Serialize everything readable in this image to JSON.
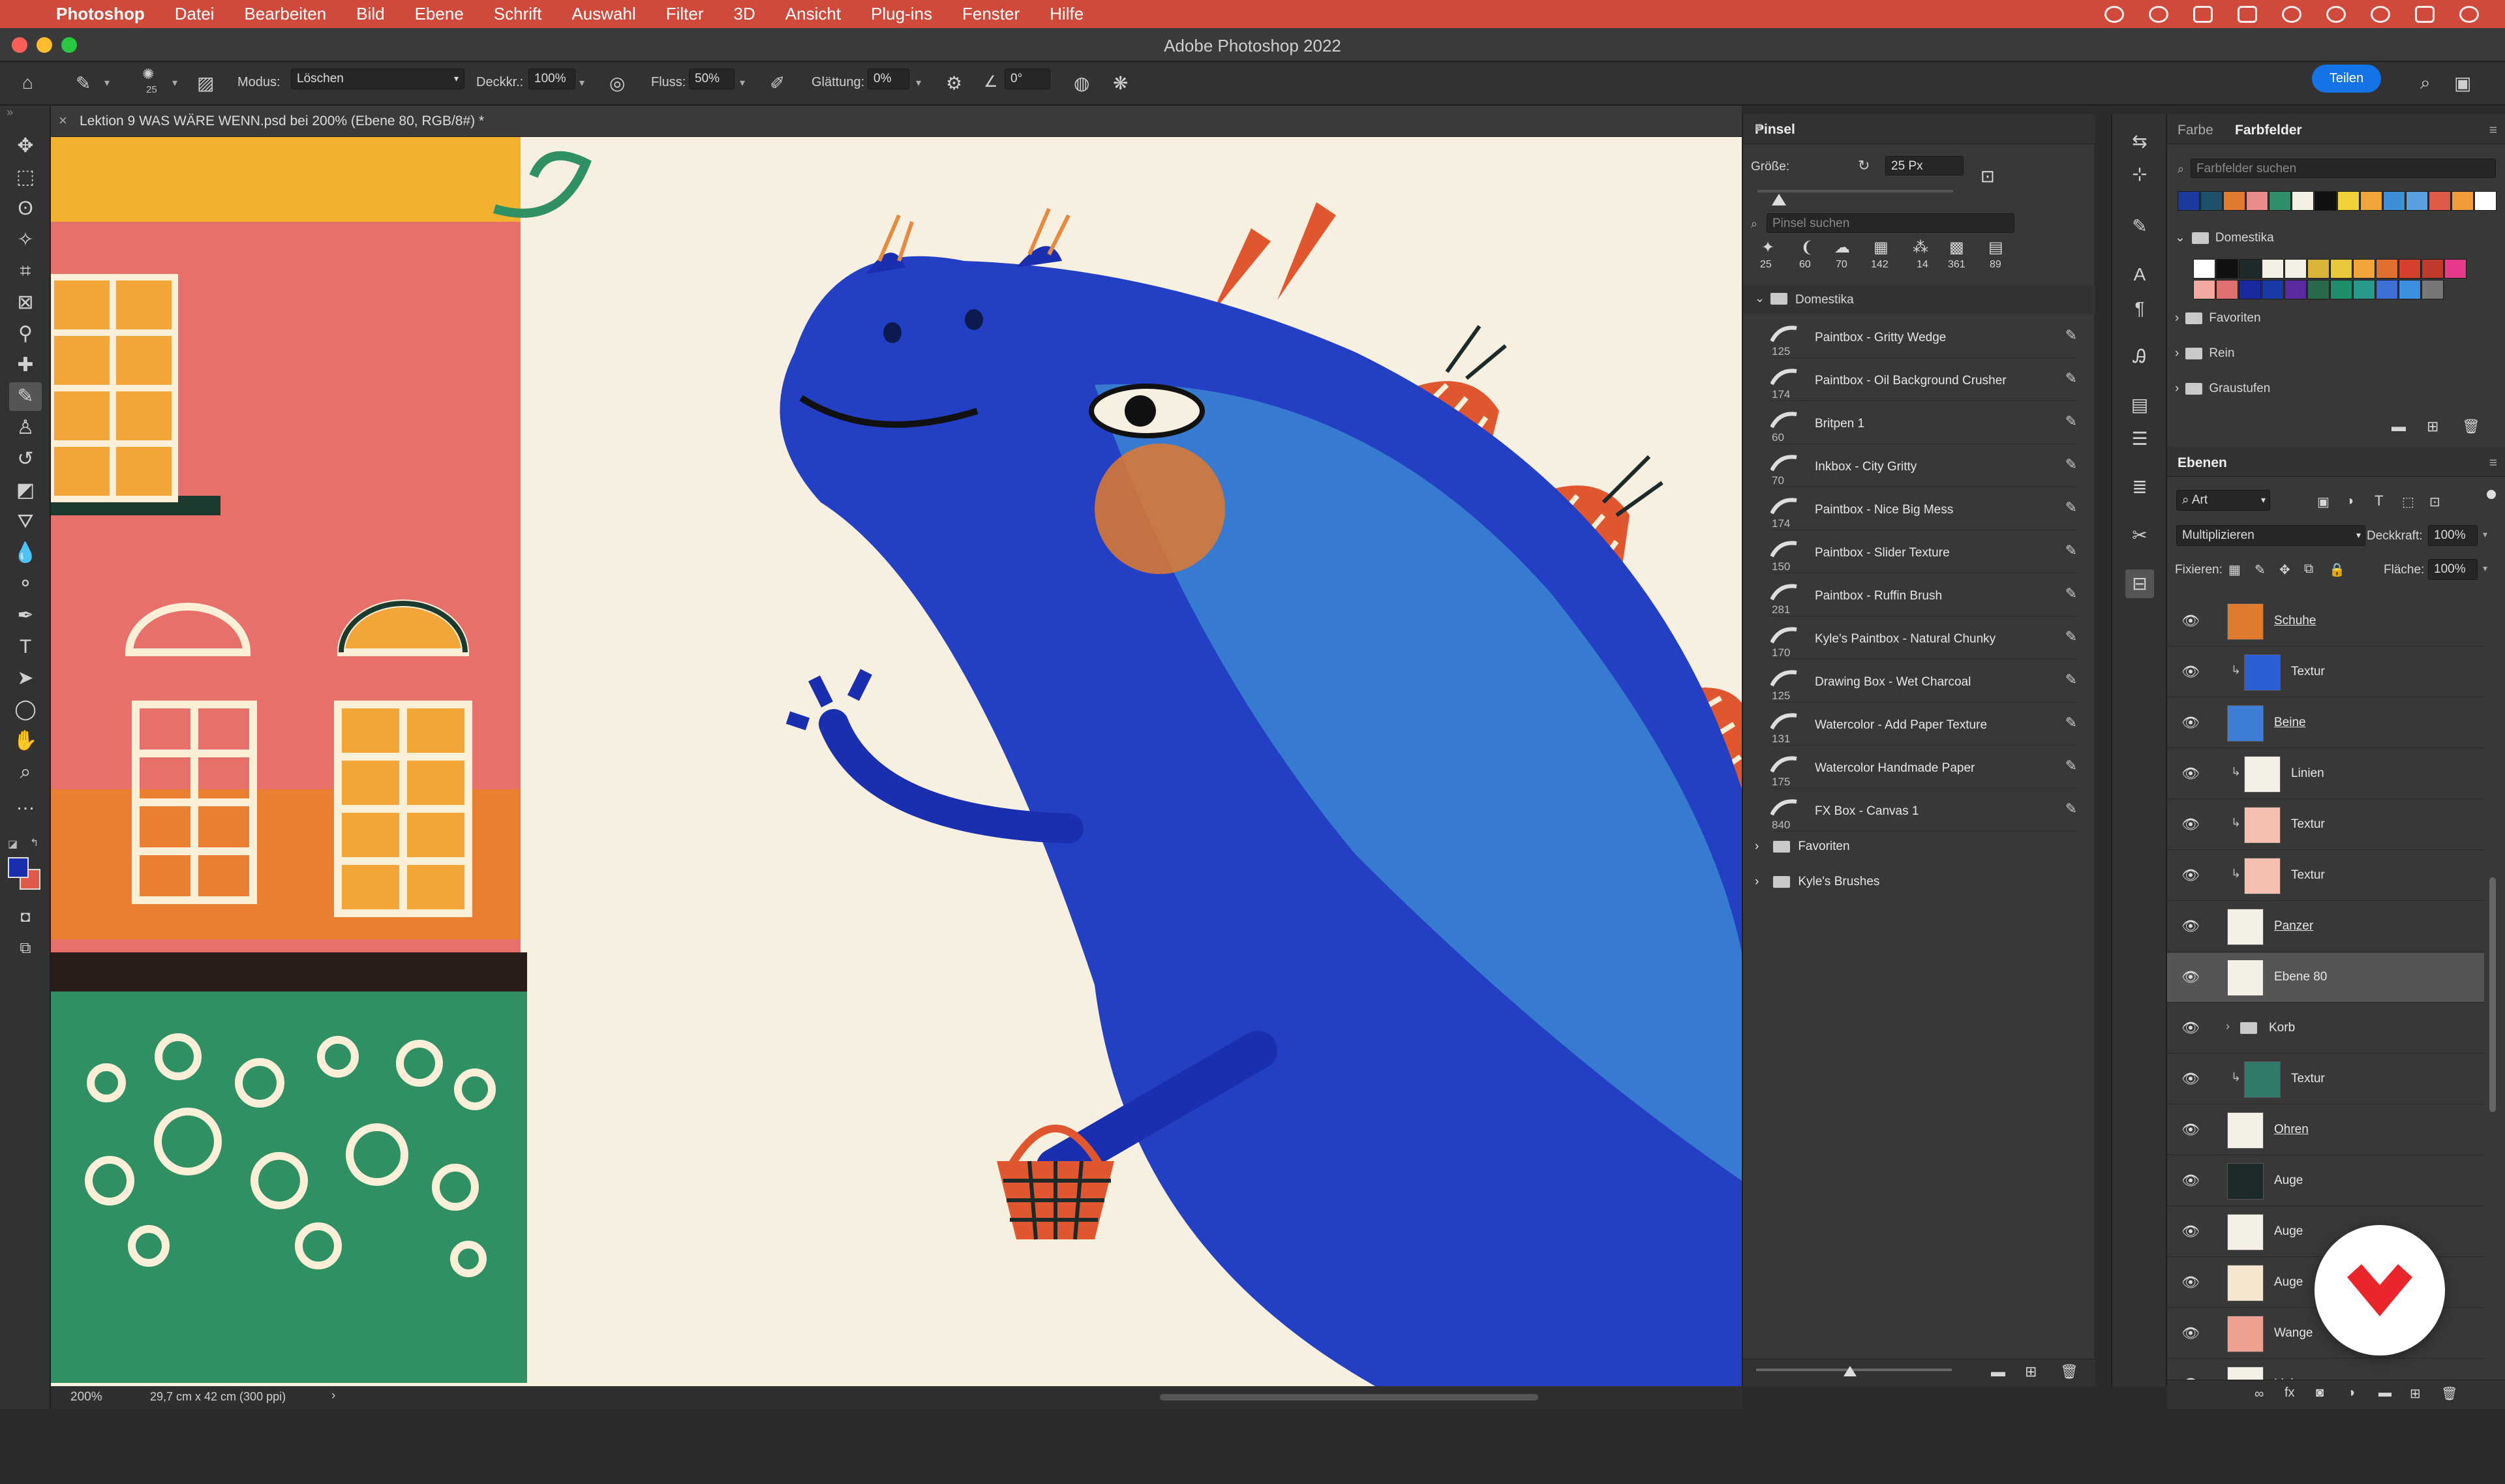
{
  "menubar": {
    "app_name": "Photoshop",
    "items": [
      "Datei",
      "Bearbeiten",
      "Bild",
      "Ebene",
      "Schrift",
      "Auswahl",
      "Filter",
      "3D",
      "Ansicht",
      "Plug-ins",
      "Fenster",
      "Hilfe"
    ],
    "color": "#cf4a3b"
  },
  "window": {
    "title": "Adobe Photoshop 2022"
  },
  "options": {
    "mode_label": "Modus:",
    "mode_value": "Löschen",
    "opacity_label": "Deckkr.:",
    "opacity_value": "100%",
    "flow_label": "Fluss:",
    "flow_value": "50%",
    "smoothing_label": "Glättung:",
    "smoothing_value": "0%",
    "angle_value": "0°",
    "brush_size_small": "25",
    "share_label": "Teilen"
  },
  "document": {
    "tab_title": "Lektion 9 WAS WÄRE WENN.psd bei 200% (Ebene 80, RGB/8#) *",
    "zoom": "200%",
    "doc_size": "29,7 cm x 42 cm (300 ppi)"
  },
  "brush_panel": {
    "title": "Pinsel",
    "size_label": "Größe:",
    "size_value": "25 Px",
    "search_placeholder": "Pinsel suchen",
    "size_presets": [
      "25",
      "60",
      "70",
      "142",
      "14",
      "361",
      "89"
    ],
    "group": "Domestika",
    "brushes": [
      {
        "name": "Paintbox - Gritty Wedge",
        "size": "125"
      },
      {
        "name": "Paintbox - Oil Background Crusher",
        "size": "174"
      },
      {
        "name": "Britpen 1",
        "size": "60"
      },
      {
        "name": "Inkbox - City Gritty",
        "size": "70"
      },
      {
        "name": "Paintbox - Nice Big Mess",
        "size": "174"
      },
      {
        "name": "Paintbox - Slider Texture",
        "size": "150"
      },
      {
        "name": "Paintbox - Ruffin Brush",
        "size": "281"
      },
      {
        "name": "Kyle's Paintbox - Natural Chunky",
        "size": "170"
      },
      {
        "name": "Drawing Box - Wet Charcoal",
        "size": "125"
      },
      {
        "name": "Watercolor - Add Paper Texture",
        "size": "131"
      },
      {
        "name": "Watercolor Handmade Paper",
        "size": "175"
      },
      {
        "name": "FX Box - Canvas 1",
        "size": "840"
      }
    ],
    "folders": [
      "Favoriten",
      "Kyle's Brushes"
    ]
  },
  "swatches_panel": {
    "tab_color": "Farbe",
    "tab_swatches": "Farbfelder",
    "search_placeholder": "Farbfelder suchen",
    "recent": [
      "#1a3a9e",
      "#1e4f6b",
      "#e07a2e",
      "#e98b8b",
      "#2f8f6a",
      "#f5f0e6",
      "#111111",
      "#f0d23a",
      "#f0a53a",
      "#3d8fd6",
      "#5aa0e0",
      "#e05a4a",
      "#f09a3a",
      "#ffffff"
    ],
    "group_domestika": "Domestika",
    "domestika_row1": [
      "#ffffff",
      "#111111",
      "#1e2a2a",
      "#f5f0e6",
      "#f5f0e6",
      "#d9b43a",
      "#e8c93a",
      "#f0a53a",
      "#e0702e",
      "#d6402e",
      "#c23a2e",
      "#e83a8a"
    ],
    "domestika_row2": [
      "#f4a9a0",
      "#e07070",
      "#1a2a9e",
      "#1a3aa8",
      "#5a2a9e",
      "#2a6a4a",
      "#1e8f6a",
      "#2a9a8a",
      "#3d6fd6",
      "#3d8fe0",
      "#777777"
    ],
    "groups": [
      "Favoriten",
      "Rein",
      "Graustufen"
    ]
  },
  "layers_panel": {
    "title": "Ebenen",
    "filter_value": "Art",
    "blend_mode": "Multiplizieren",
    "opacity_label": "Deckkraft:",
    "opacity_value": "100%",
    "lock_label": "Fixieren:",
    "fill_label": "Fläche:",
    "fill_value": "100%",
    "layers": [
      {
        "name": "Schuhe",
        "clipped": false,
        "underline": true
      },
      {
        "name": "Textur",
        "clipped": true,
        "underline": false
      },
      {
        "name": "Beine",
        "clipped": false,
        "underline": true
      },
      {
        "name": "Linien",
        "clipped": true,
        "underline": false
      },
      {
        "name": "Textur",
        "clipped": true,
        "underline": false
      },
      {
        "name": "Textur",
        "clipped": true,
        "underline": false
      },
      {
        "name": "Panzer",
        "clipped": false,
        "underline": true
      },
      {
        "name": "Ebene 80",
        "clipped": false,
        "underline": false,
        "selected": true
      },
      {
        "name": "Korb",
        "clipped": false,
        "underline": false,
        "group": true
      },
      {
        "name": "Textur",
        "clipped": true,
        "underline": false
      },
      {
        "name": "Ohren",
        "clipped": false,
        "underline": true
      },
      {
        "name": "Auge",
        "clipped": false,
        "underline": false
      },
      {
        "name": "Auge",
        "clipped": false,
        "underline": false
      },
      {
        "name": "Auge",
        "clipped": false,
        "underline": false
      },
      {
        "name": "Wange",
        "clipped": false,
        "underline": false
      },
      {
        "name": "Linien",
        "clipped": false,
        "underline": false
      }
    ]
  },
  "colors": {
    "foreground": "#1a2fb0",
    "background": "#e05a4a",
    "accent": "#1473e6"
  }
}
